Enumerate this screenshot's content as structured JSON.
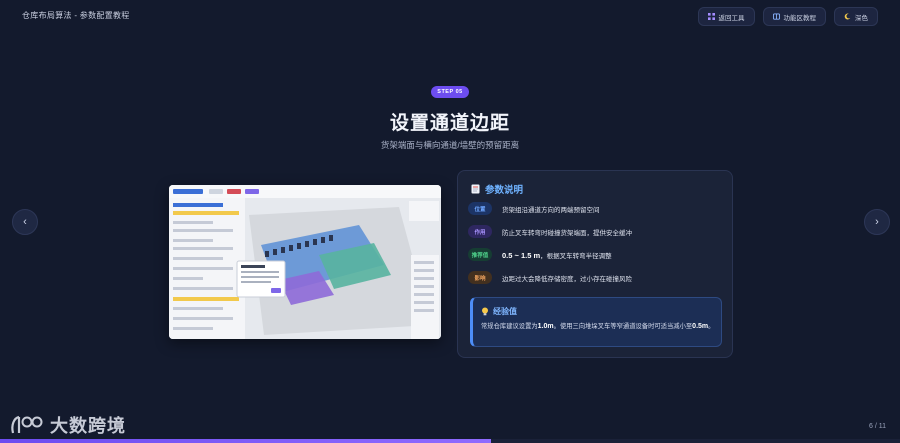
{
  "app": {
    "title": "仓库布局算法 - 参数配置教程",
    "buttons": [
      {
        "label": "返回工具",
        "icon": "grid-icon"
      },
      {
        "label": "功能区教程",
        "icon": "book-icon"
      },
      {
        "label": "深色",
        "icon": "moon-icon"
      }
    ]
  },
  "slide": {
    "step": "STEP 05",
    "title": "设置通道边距",
    "subtitle": "货架端面与横向通道/墙壁的预留距离"
  },
  "panel": {
    "heading": "参数说明",
    "rows": [
      {
        "tag": "位置",
        "text": "货架组沿通道方向的两端预留空间",
        "tag_color": "#2f6fe0",
        "tag_bg": "#1c3466"
      },
      {
        "tag": "作用",
        "text": "防止叉车转弯时碰撞货架端面，提供安全缓冲",
        "tag_color": "#9b7cff",
        "tag_bg": "#2e2760"
      },
      {
        "tag": "推荐值",
        "text_bold": "0.5 ~ 1.5 m",
        "text": "，根据叉车转弯半径调整",
        "tag_color": "#35c47a",
        "tag_bg": "#163d33"
      },
      {
        "tag": "影响",
        "text": "边距过大会降低存储密度，过小存在碰撞风险",
        "tag_color": "#e8944a",
        "tag_bg": "#43301f"
      }
    ],
    "tip": {
      "heading": "经验值",
      "text_1": "常规仓库建议设置为",
      "value_1": "1.0m",
      "text_2": "。使用三向堆垛叉车等窄通道设备时可适当减小至",
      "value_2": "0.5m",
      "text_3": "。"
    }
  },
  "nav": {
    "prev": "‹",
    "next": "›"
  },
  "footer": {
    "logo_text": "大数跨境",
    "page": "6 / 11",
    "progress": 0.545
  }
}
